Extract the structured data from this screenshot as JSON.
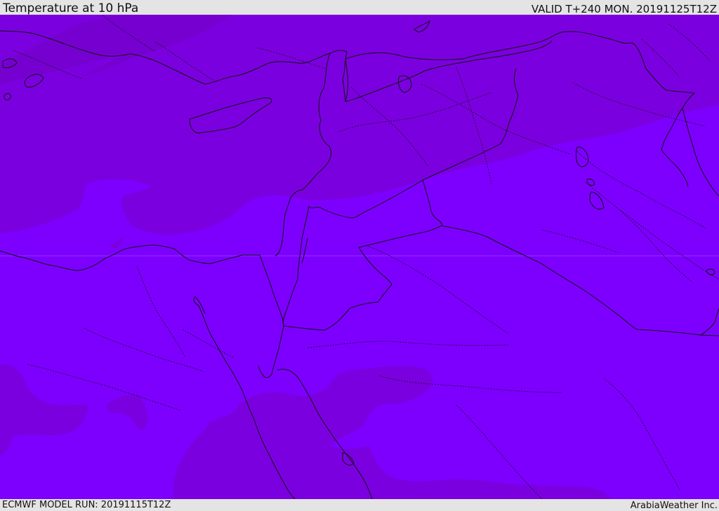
{
  "header": {
    "title": "Temperature at 10 hPa",
    "valid": "VALID T+240 MON. 20191125T12Z"
  },
  "footer": {
    "run": "ECMWF MODEL RUN: 20191115T12Z",
    "credit": "ArabiaWeather Inc."
  },
  "map": {
    "colors": {
      "warm_band": "#7b00df",
      "cool_band": "#7d00ff",
      "coastline": "#000000",
      "borders": "#111111"
    }
  }
}
